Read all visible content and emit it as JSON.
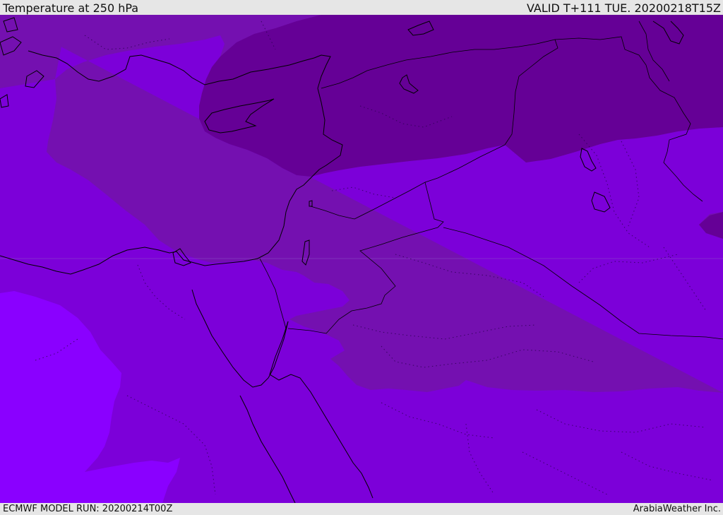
{
  "header": {
    "title": "Temperature at 250 hPa",
    "valid_time": "VALID T+111 TUE. 20200218T15Z"
  },
  "footer": {
    "model_run": "ECMWF MODEL RUN: 20200214T00Z",
    "credit": "ArabiaWeather Inc."
  },
  "map": {
    "colors": {
      "band_coldest": "#650096",
      "band_cold": "#7410b0",
      "band_mid": "#7c00d9",
      "band_warm": "#8300f2",
      "band_warmest": "#8a00ff",
      "coastline": "#000000",
      "background": "#e6e6e6"
    }
  }
}
